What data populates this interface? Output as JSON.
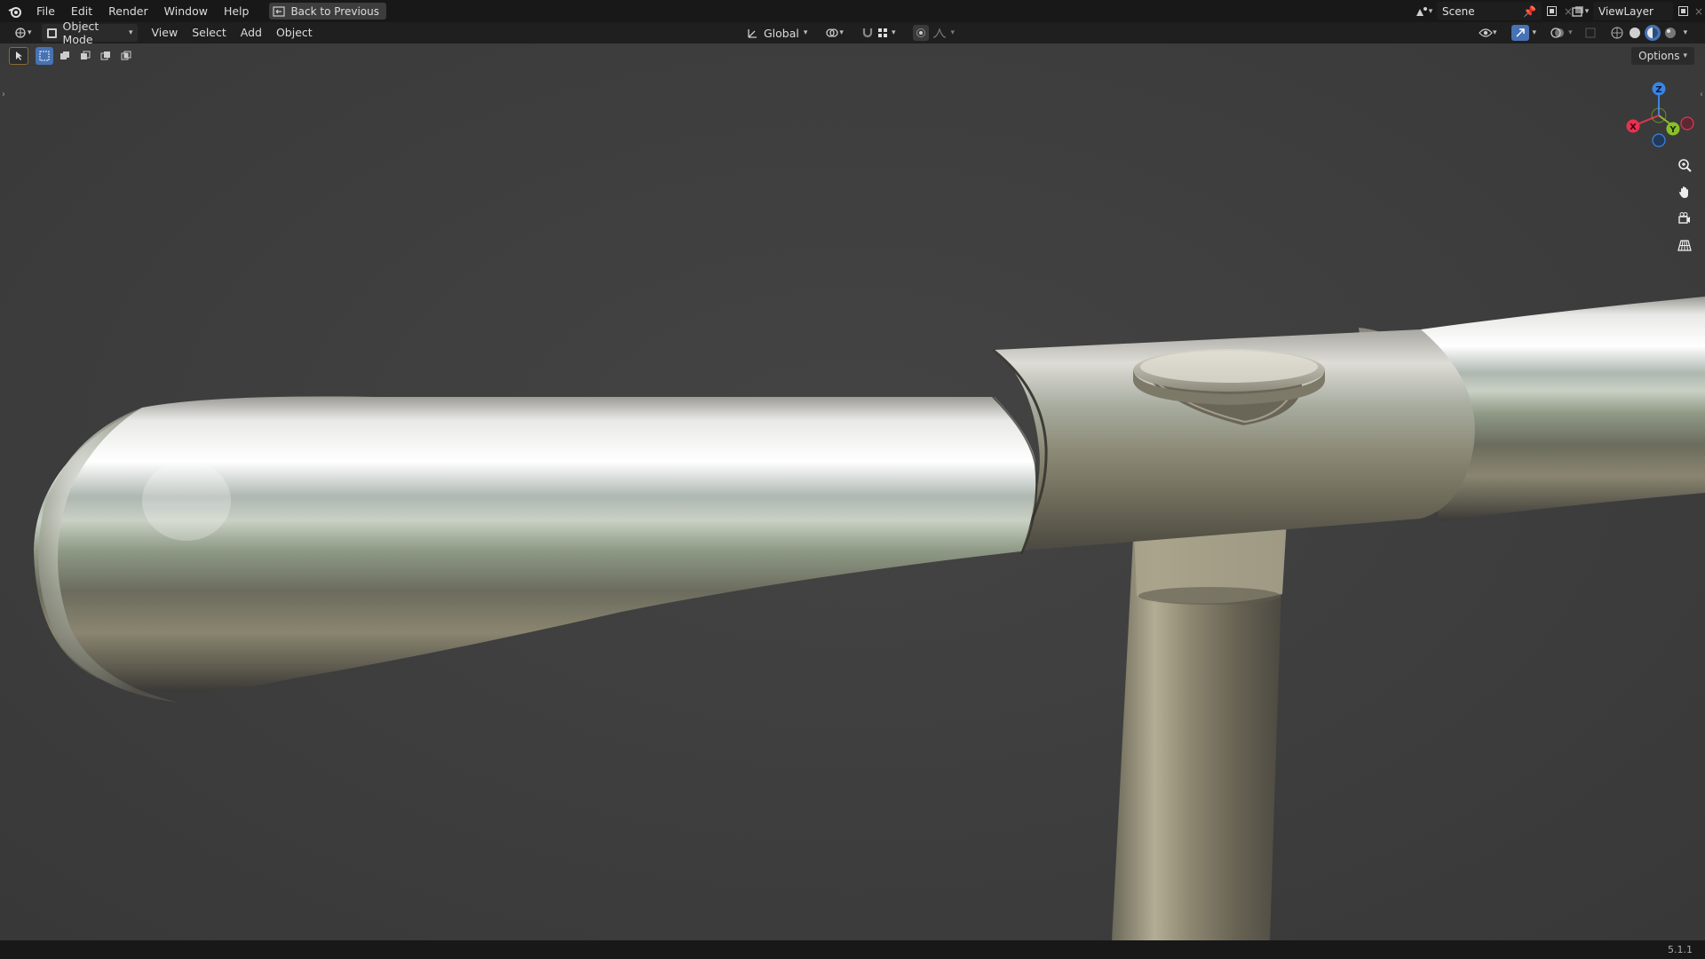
{
  "menu": {
    "file": "File",
    "edit": "Edit",
    "render": "Render",
    "window": "Window",
    "help": "Help",
    "back": "Back to Previous"
  },
  "scene": {
    "name": "Scene",
    "view_layer": "ViewLayer"
  },
  "header": {
    "mode": "Object Mode",
    "view": "View",
    "select": "Select",
    "add": "Add",
    "object": "Object",
    "orientation": "Global"
  },
  "viewport": {
    "options": "Options",
    "gizmo": {
      "x": "X",
      "y": "Y",
      "z": "Z"
    }
  },
  "status": {
    "version": "5.1.1"
  },
  "colors": {
    "x_axis": "#e8324f",
    "y_axis": "#8bbf2a",
    "z_axis": "#3a84e6",
    "accent": "#4772b3"
  }
}
